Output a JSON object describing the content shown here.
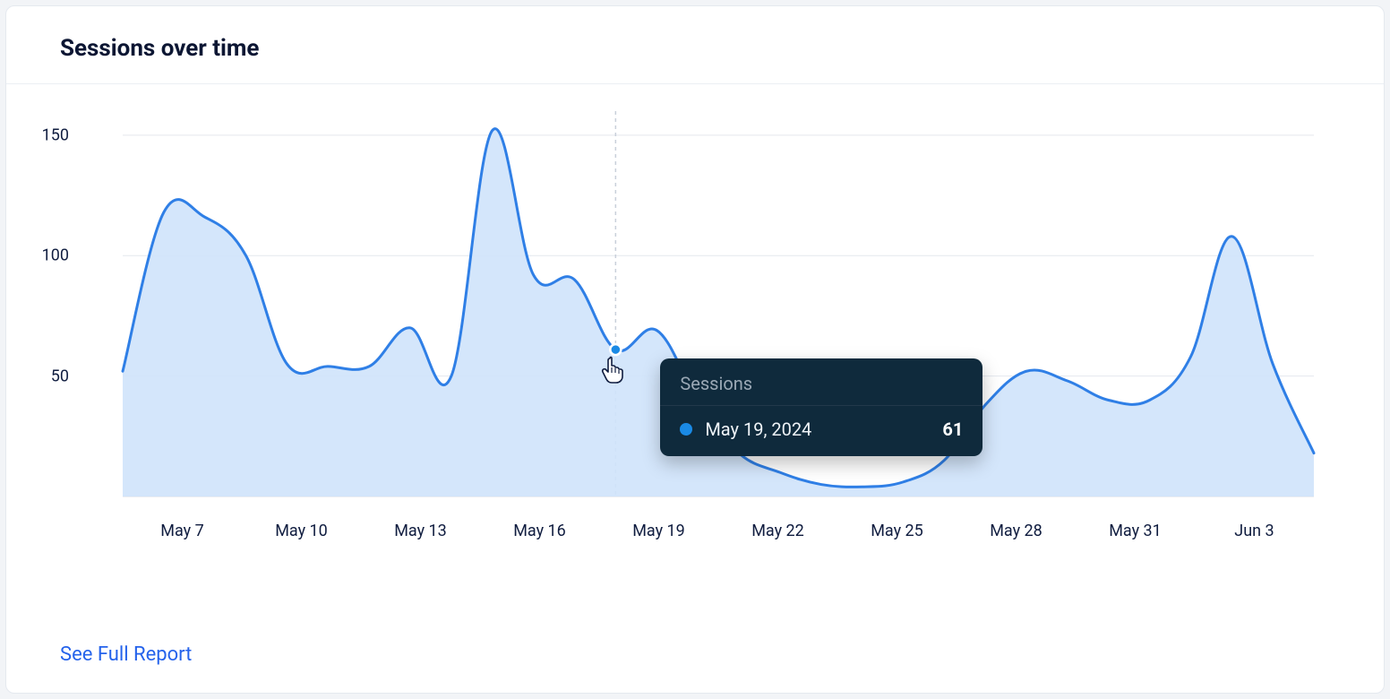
{
  "card": {
    "title": "Sessions over time",
    "footer_link_label": "See Full Report"
  },
  "tooltip": {
    "title": "Sessions",
    "date": "May 19, 2024",
    "value": "61"
  },
  "chart_data": {
    "type": "area",
    "title": "Sessions over time",
    "xlabel": "",
    "ylabel": "",
    "ylim": [
      0,
      160
    ],
    "y_ticks": [
      50,
      100,
      150
    ],
    "x_ticks": [
      "May 7",
      "May 10",
      "May 13",
      "May 16",
      "May 19",
      "May 22",
      "May 25",
      "May 28",
      "May 31",
      "Jun 3"
    ],
    "series": [
      {
        "name": "Sessions",
        "color": "#2f7fe6",
        "x": [
          "May 7",
          "May 8",
          "May 9",
          "May 10",
          "May 11",
          "May 12",
          "May 13",
          "May 14",
          "May 15",
          "May 16",
          "May 17",
          "May 18",
          "May 19",
          "May 20",
          "May 21",
          "May 22",
          "May 23",
          "May 24",
          "May 25",
          "May 26",
          "May 27",
          "May 28",
          "May 29",
          "May 30",
          "May 31",
          "Jun 1",
          "Jun 2",
          "Jun 3",
          "Jun 4",
          "Jun 5"
        ],
        "values": [
          52,
          118,
          116,
          100,
          55,
          54,
          54,
          70,
          50,
          152,
          92,
          90,
          61,
          69,
          40,
          18,
          10,
          5,
          4,
          6,
          15,
          38,
          52,
          48,
          40,
          40,
          58,
          108,
          55,
          18
        ]
      }
    ],
    "hover": {
      "x": "May 19",
      "date_full": "May 19, 2024",
      "value": 61
    }
  }
}
